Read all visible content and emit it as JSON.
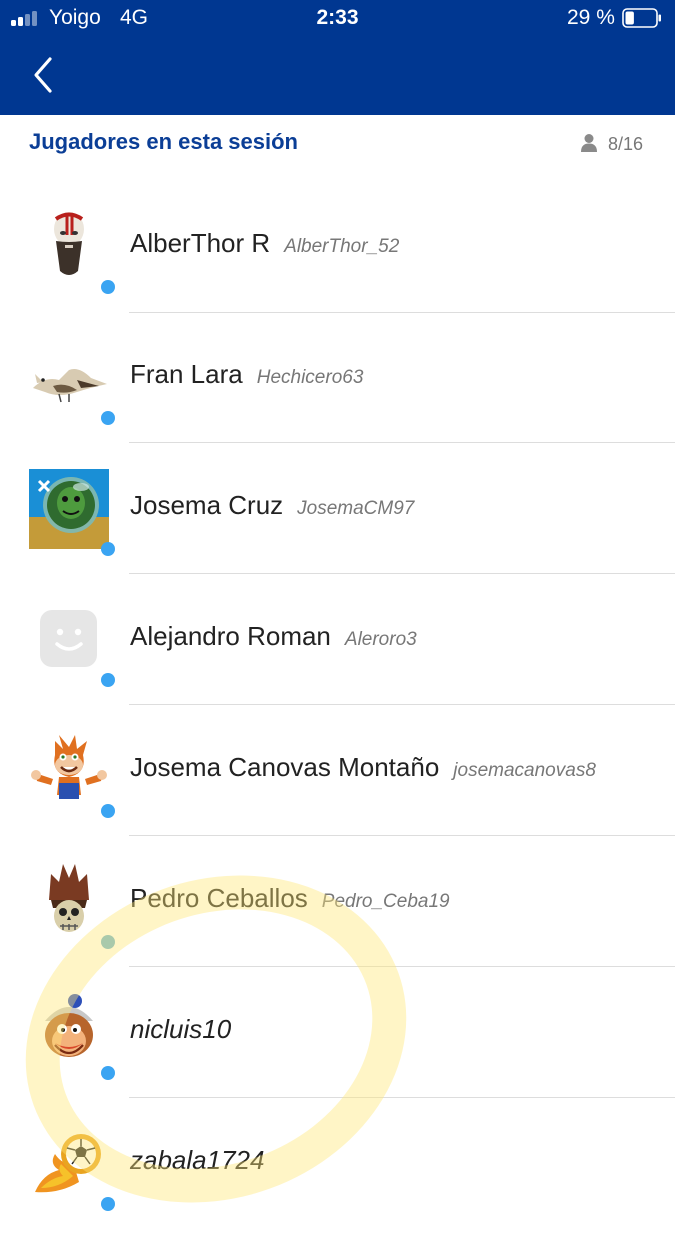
{
  "status_bar": {
    "carrier": "Yoigo",
    "network": "4G",
    "time": "2:33",
    "battery": "29 %",
    "battery_level": 0.29
  },
  "nav": {
    "back_icon": "chevron-left-icon"
  },
  "section": {
    "title": "Jugadores en esta sesión",
    "count": "8/16",
    "count_icon": "person-icon"
  },
  "players": [
    {
      "name": "AlberThor R",
      "online_id": "AlberThor_52",
      "avatar": "warrior-avatar",
      "status_color": "#3aa4f2"
    },
    {
      "name": "Fran Lara",
      "online_id": "Hechicero63",
      "avatar": "bird-avatar",
      "status_color": "#3aa4f2"
    },
    {
      "name": "Josema Cruz",
      "online_id": "JosemaCM97",
      "avatar": "alien-astronaut-avatar",
      "status_color": "#3aa4f2"
    },
    {
      "name": "Alejandro Roman",
      "online_id": "Aleroro3",
      "avatar": "default-face-avatar",
      "status_color": "#3aa4f2"
    },
    {
      "name": "Josema Canovas Montaño",
      "online_id": "josemacanovas8",
      "avatar": "bandicoot-avatar",
      "status_color": "#3aa4f2"
    },
    {
      "name": "Pedro Ceballos",
      "online_id": "Pedro_Ceba19",
      "avatar": "skull-helmet-avatar",
      "status_color": "#3aa4f2"
    },
    {
      "name": "nicluis10",
      "online_id": "",
      "avatar": "ape-helmet-avatar",
      "status_color": "#3aa4f2"
    },
    {
      "name": "zabala1724",
      "online_id": "",
      "avatar": "flaming-football-avatar",
      "status_color": "#3aa4f2"
    }
  ]
}
